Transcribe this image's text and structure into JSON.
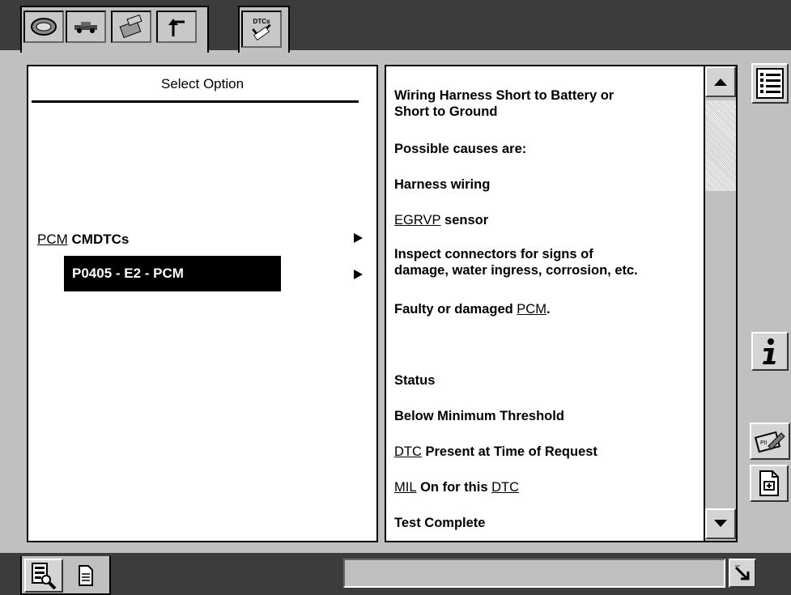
{
  "window": {
    "title": ""
  },
  "top_tabs": [
    {
      "name": "vehicle-tab",
      "icon": "vehicle-badge-icon"
    },
    {
      "name": "car-tab",
      "icon": "car-icon"
    },
    {
      "name": "toolbox-tab",
      "icon": "toolbox-icon"
    },
    {
      "name": "return-tab",
      "icon": "return-arrow-icon"
    },
    {
      "name": "dtcs-tab",
      "icon": "dtc-check-icon",
      "label": "DTCs",
      "active": true
    }
  ],
  "left_panel": {
    "title": "Select Option",
    "option_prefix": "PCM",
    "option_rest": " CMDTCs",
    "selected_item": "P0405 - E2 - PCM"
  },
  "right_panel": {
    "lines": {
      "l1a": "Wiring Harness Short to Battery or",
      "l1b": "Short to Ground",
      "l2": "Possible causes are:",
      "l3": "Harness wiring",
      "l4_link": "EGRVP",
      "l4_rest": " sensor",
      "l5a": "Inspect connectors for signs of",
      "l5b": "damage, water ingress, corrosion, etc.",
      "l6_pre": "Faulty or damaged ",
      "l6_link": "PCM",
      "l6_post": ".",
      "status": "Status",
      "below": "Below Minimum Threshold",
      "dtc_link": "DTC",
      "dtc_rest": " Present at Time of Request",
      "mil_link": "MIL",
      "mil_mid": " On for this ",
      "mil_dtc": "DTC",
      "test": "Test Complete"
    }
  },
  "side_buttons": [
    "list-icon",
    "info-icon",
    "print-pad-icon",
    "document-icon"
  ],
  "bottom_tabs": [
    "inspect-icon",
    "page-icon"
  ],
  "status_text": ""
}
